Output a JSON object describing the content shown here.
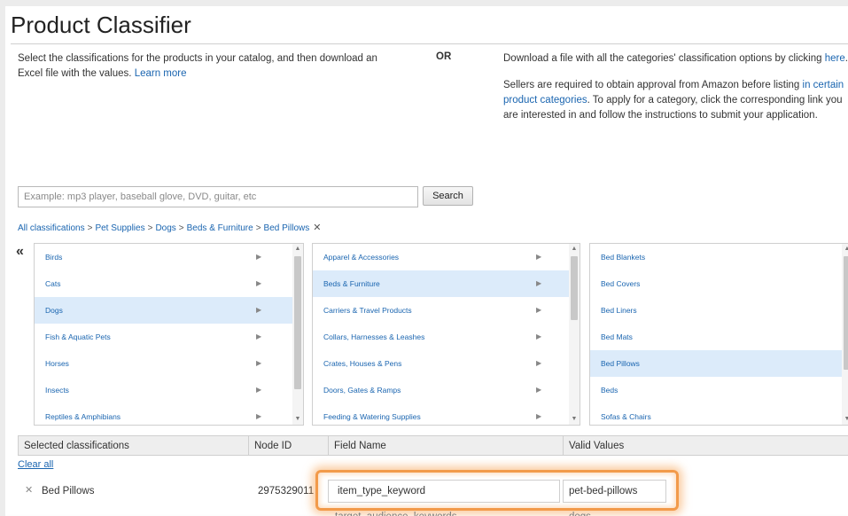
{
  "title": "Product Classifier",
  "intro": {
    "left_text": "Select the classifications for the products in your catalog, and then download an Excel file with the values.",
    "learn_more": "Learn more",
    "or_label": "OR",
    "right_download_prefix": "Download a file with all the categories' classification options by clicking",
    "right_download_link": "here",
    "right_download_suffix": ".",
    "approval_prefix": "Sellers are required to obtain approval from Amazon before listing",
    "approval_link": "in certain product categories",
    "approval_suffix": ". To apply for a category, click the corresponding link you are interested in and follow the instructions to submit your application."
  },
  "search": {
    "placeholder": "Example: mp3 player, baseball glove, DVD, guitar, etc",
    "button_label": "Search"
  },
  "breadcrumb": {
    "items": [
      "All classifications",
      "Pet Supplies",
      "Dogs",
      "Beds & Furniture",
      "Bed Pillows"
    ],
    "separator": ">",
    "remove_glyph": "✕"
  },
  "back_glyph": "«",
  "columns": [
    {
      "items": [
        "Birds",
        "Cats",
        "Dogs",
        "Fish & Aquatic Pets",
        "Horses",
        "Insects",
        "Reptiles & Amphibians"
      ],
      "selected_index": 2
    },
    {
      "items": [
        "Apparel & Accessories",
        "Beds & Furniture",
        "Carriers & Travel Products",
        "Collars, Harnesses & Leashes",
        "Crates, Houses & Pens",
        "Doors, Gates & Ramps",
        "Feeding & Watering Supplies"
      ],
      "selected_index": 1
    },
    {
      "items": [
        "Bed Blankets",
        "Bed Covers",
        "Bed Liners",
        "Bed Mats",
        "Bed Pillows",
        "Beds",
        "Sofas & Chairs"
      ],
      "selected_index": 4
    }
  ],
  "table": {
    "headers": [
      "Selected classifications",
      "Node ID",
      "Field Name",
      "Valid Values"
    ],
    "clear_all": "Clear all",
    "rows": [
      {
        "remove_glyph": "✕",
        "classification": "Bed Pillows",
        "node_id": "2975329011",
        "field_name": "item_type_keyword",
        "valid_values": "pet-bed-pillows"
      },
      {
        "field_name": "target_audience_keywords",
        "valid_values": "dogs"
      }
    ]
  },
  "colors": {
    "link": "#1a65b0",
    "selected_row": "#dcebfa",
    "highlight": "#f29a4a"
  }
}
